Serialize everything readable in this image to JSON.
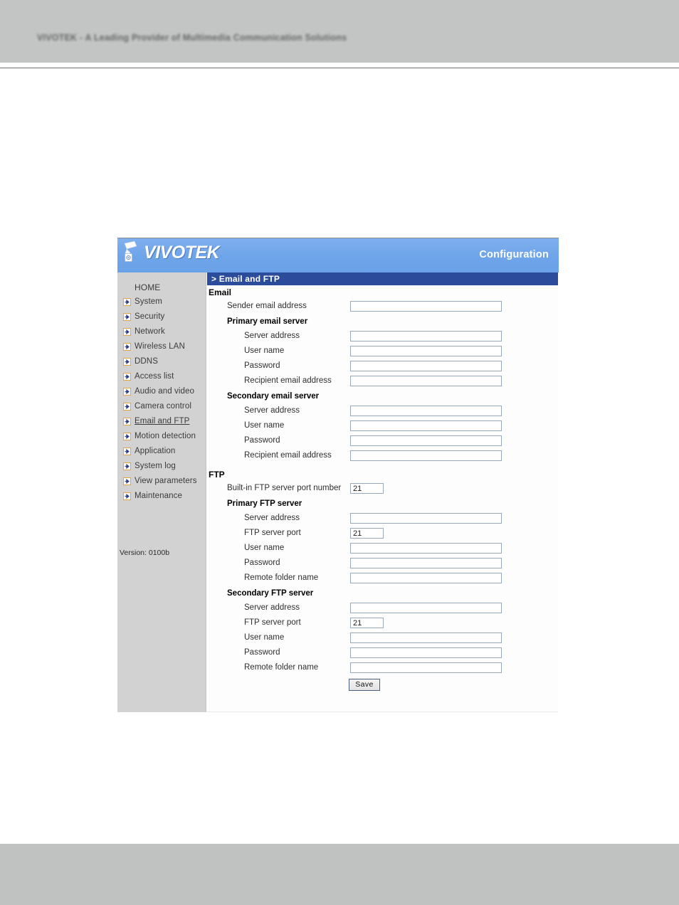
{
  "page": {
    "tagline": "VIVOTEK - A Leading Provider of Multimedia Communication Solutions"
  },
  "window": {
    "brand": "VIVOTEK",
    "banner_right_label": "Configuration",
    "page_title": "> Email and FTP",
    "colors": {
      "banner_blue": "#6ea4e9",
      "titlebar_blue": "#2b4b9b",
      "sidebar_gray": "#d2d2d2",
      "input_border": "#97a9bb",
      "icon_border": "#e8a33d",
      "icon_arrow": "#2c3f86"
    }
  },
  "sidebar": {
    "items": [
      {
        "label": "HOME",
        "icon": "",
        "active": false
      },
      {
        "label": "System",
        "icon": "arrow-right-icon",
        "active": false
      },
      {
        "label": "Security",
        "icon": "arrow-right-icon",
        "active": false
      },
      {
        "label": "Network",
        "icon": "arrow-right-icon",
        "active": false
      },
      {
        "label": "Wireless LAN",
        "icon": "arrow-right-icon",
        "active": false
      },
      {
        "label": "DDNS",
        "icon": "arrow-right-icon",
        "active": false
      },
      {
        "label": "Access list",
        "icon": "arrow-right-icon",
        "active": false
      },
      {
        "label": "Audio and video",
        "icon": "arrow-right-icon",
        "active": false
      },
      {
        "label": "Camera control",
        "icon": "arrow-right-icon",
        "active": false
      },
      {
        "label": "Email and FTP",
        "icon": "arrow-right-icon",
        "active": true
      },
      {
        "label": "Motion detection",
        "icon": "arrow-right-icon",
        "active": false
      },
      {
        "label": "Application",
        "icon": "arrow-right-icon",
        "active": false
      },
      {
        "label": "System log",
        "icon": "arrow-right-icon",
        "active": false
      },
      {
        "label": "View parameters",
        "icon": "arrow-right-icon",
        "active": false
      },
      {
        "label": "Maintenance",
        "icon": "arrow-right-icon",
        "active": false
      }
    ],
    "version": "Version: 0100b"
  },
  "form": {
    "email_section": "Email",
    "sender_email_address_label": "Sender email address",
    "sender_email_address_value": "",
    "primary_email_server_head": "Primary email server",
    "secondary_email_server_head": "Secondary email server",
    "email_primary": {
      "server_address_label": "Server address",
      "server_address_value": "",
      "user_name_label": "User name",
      "user_name_value": "",
      "password_label": "Password",
      "password_value": "",
      "recipient_email_address_label": "Recipient email address",
      "recipient_email_address_value": ""
    },
    "email_secondary": {
      "server_address_label": "Server address",
      "server_address_value": "",
      "user_name_label": "User name",
      "user_name_value": "",
      "password_label": "Password",
      "password_value": "",
      "recipient_email_address_label": "Recipient email address",
      "recipient_email_address_value": ""
    },
    "ftp_section": "FTP",
    "builtin_ftp_port_label": "Built-in FTP server port number",
    "builtin_ftp_port_value": "21",
    "primary_ftp_server_head": "Primary FTP server",
    "secondary_ftp_server_head": "Secondary FTP server",
    "ftp_primary": {
      "server_address_label": "Server address",
      "server_address_value": "",
      "ftp_server_port_label": "FTP server port",
      "ftp_server_port_value": "21",
      "user_name_label": "User name",
      "user_name_value": "",
      "password_label": "Password",
      "password_value": "",
      "remote_folder_name_label": "Remote folder name",
      "remote_folder_name_value": ""
    },
    "ftp_secondary": {
      "server_address_label": "Server address",
      "server_address_value": "",
      "ftp_server_port_label": "FTP server port",
      "ftp_server_port_value": "21",
      "user_name_label": "User name",
      "user_name_value": "",
      "password_label": "Password",
      "password_value": "",
      "remote_folder_name_label": "Remote folder name",
      "remote_folder_name_value": ""
    },
    "save_label": "Save"
  }
}
